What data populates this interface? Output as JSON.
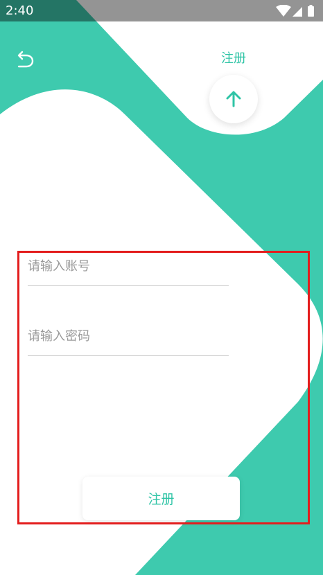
{
  "status_bar": {
    "time": "2:40",
    "icons": [
      "wifi-icon",
      "signal-icon",
      "battery-icon"
    ]
  },
  "header": {
    "title": "注册",
    "back_icon": "back-arrow-icon",
    "up_icon": "arrow-up-icon"
  },
  "form": {
    "account_placeholder": "请输入账号",
    "account_value": "",
    "password_placeholder": "请输入密码",
    "password_value": "",
    "submit_label": "注册"
  },
  "colors": {
    "accent": "#2fc4a6",
    "highlight": "#e31d1d"
  }
}
